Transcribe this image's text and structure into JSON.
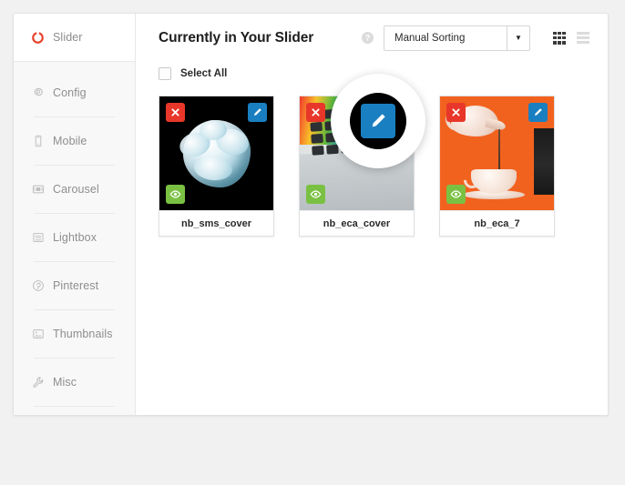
{
  "brand": {
    "label": "Slider",
    "icon": "slider-ring-icon",
    "color": "#e8402a"
  },
  "sidebar": {
    "items": [
      {
        "label": "Config",
        "icon": "gear-icon"
      },
      {
        "label": "Mobile",
        "icon": "mobile-phone-icon"
      },
      {
        "label": "Carousel",
        "icon": "carousel-icon"
      },
      {
        "label": "Lightbox",
        "icon": "lightbox-icon"
      },
      {
        "label": "Pinterest",
        "icon": "pinterest-icon"
      },
      {
        "label": "Thumbnails",
        "icon": "thumbnails-icon"
      },
      {
        "label": "Misc",
        "icon": "wrench-icon"
      }
    ]
  },
  "header": {
    "title": "Currently in Your Slider",
    "help_icon": "question-mark-circle-icon",
    "sort": {
      "selected": "Manual Sorting",
      "arrow": "▼",
      "options": [
        "Manual Sorting"
      ]
    },
    "views": [
      {
        "name": "grid-view-button",
        "icon": "grid-icon",
        "active": true
      },
      {
        "name": "list-view-button",
        "icon": "list-icon",
        "active": false
      }
    ]
  },
  "toolbar": {
    "select_all_label": "Select All",
    "select_all_checked": false
  },
  "cards": [
    {
      "caption": "nb_sms_cover",
      "art": "white-blue-flower-on-black",
      "actions": {
        "delete": {
          "icon": "close-x-icon",
          "color": "#e8372a"
        },
        "edit": {
          "icon": "pencil-icon",
          "color": "#1a7fc1"
        },
        "visibility": {
          "icon": "eye-icon",
          "color": "#7ac143"
        }
      }
    },
    {
      "caption": "nb_eca_cover",
      "art": "laptop-with-colorful-apps",
      "actions": {
        "delete": {
          "icon": "close-x-icon",
          "color": "#e8372a"
        },
        "edit": {
          "icon": "pencil-icon",
          "color": "#1a7fc1"
        },
        "visibility": {
          "icon": "eye-icon",
          "color": "#7ac143"
        }
      }
    },
    {
      "caption": "nb_eca_7",
      "art": "teapot-pouring-into-cup-orange",
      "actions": {
        "delete": {
          "icon": "close-x-icon",
          "color": "#e8372a"
        },
        "edit": {
          "icon": "pencil-icon",
          "color": "#1a7fc1"
        },
        "visibility": {
          "icon": "eye-icon",
          "color": "#7ac143"
        }
      }
    }
  ],
  "magnifier": {
    "target_icon": "pencil-icon",
    "target_label": "edit-button",
    "target_color": "#1a7fc1"
  }
}
